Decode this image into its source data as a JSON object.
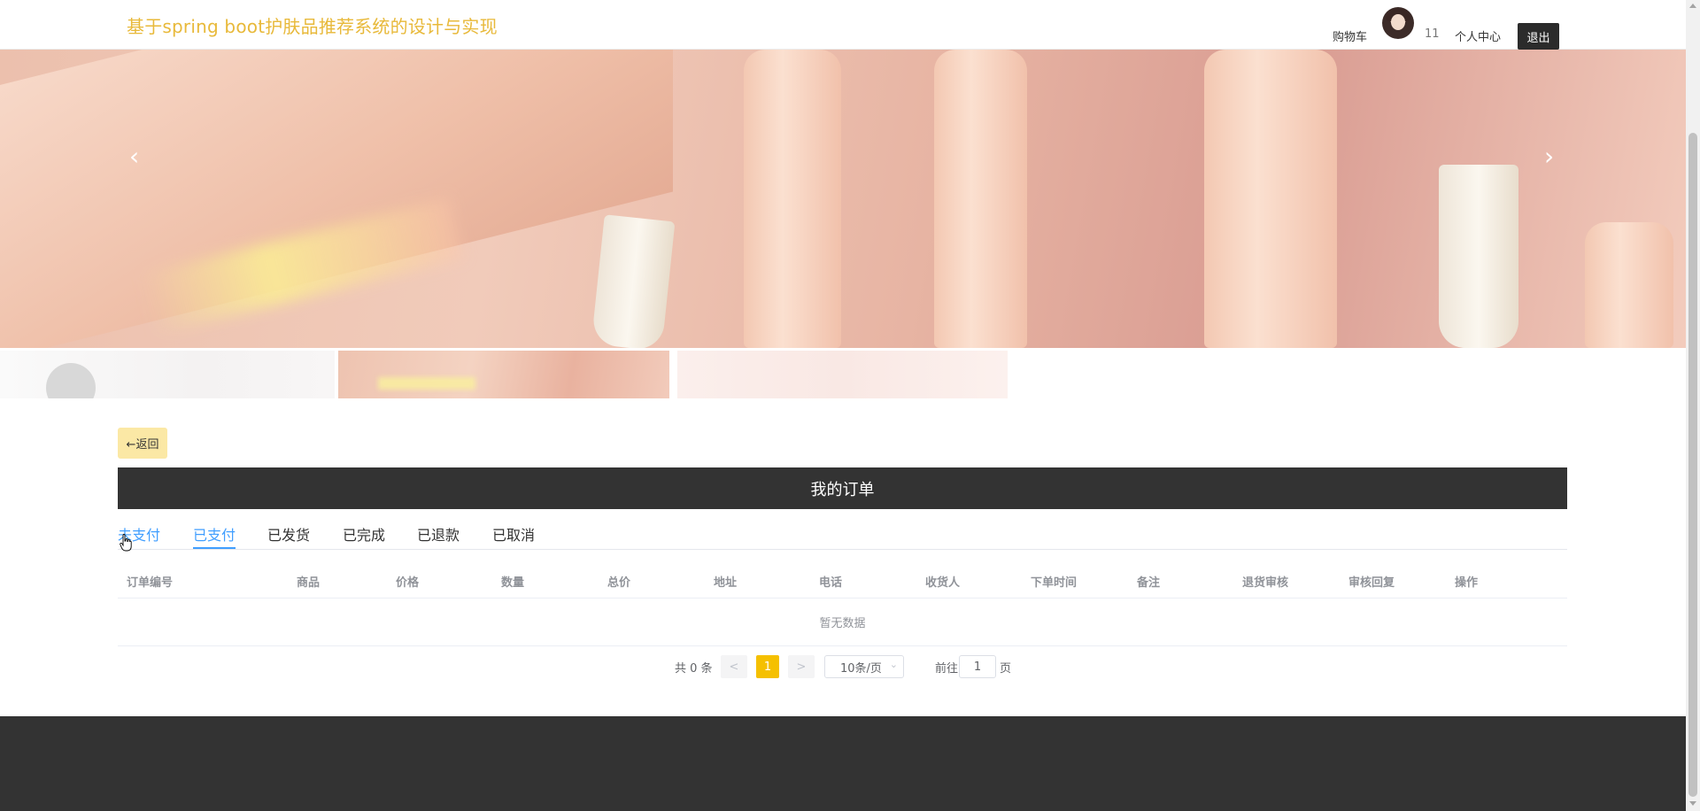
{
  "header": {
    "site_title": "基于spring boot护肤品推荐系统的设计与实现",
    "cart_label": "购物车",
    "user_count": "11",
    "user_center_label": "个人中心",
    "logout_label": "退出"
  },
  "carousel": {
    "prev_icon": "‹",
    "next_icon": "›"
  },
  "main": {
    "back_label": "←返回",
    "section_title": "我的订单",
    "tabs": [
      {
        "label": "未支付"
      },
      {
        "label": "已支付"
      },
      {
        "label": "已发货"
      },
      {
        "label": "已完成"
      },
      {
        "label": "已退款"
      },
      {
        "label": "已取消"
      }
    ],
    "active_tab": "已支付",
    "table": {
      "columns": [
        "订单编号",
        "商品",
        "价格",
        "数量",
        "总价",
        "地址",
        "电话",
        "收货人",
        "下单时间",
        "备注",
        "退货审核",
        "审核回复",
        "操作"
      ],
      "rows": [],
      "empty_text": "暂无数据"
    },
    "pagination": {
      "total_text": "共 0 条",
      "prev": "<",
      "current_page": "1",
      "next": ">",
      "page_size": "10条/页",
      "goto_label": "前往",
      "goto_value": "1",
      "page_label": "页"
    }
  },
  "colors": {
    "brand_title": "#e8b93a",
    "accent_blue": "#409eff",
    "page_active": "#f5c000",
    "dark": "#333333",
    "back_button_bg": "#fbe8a5"
  }
}
